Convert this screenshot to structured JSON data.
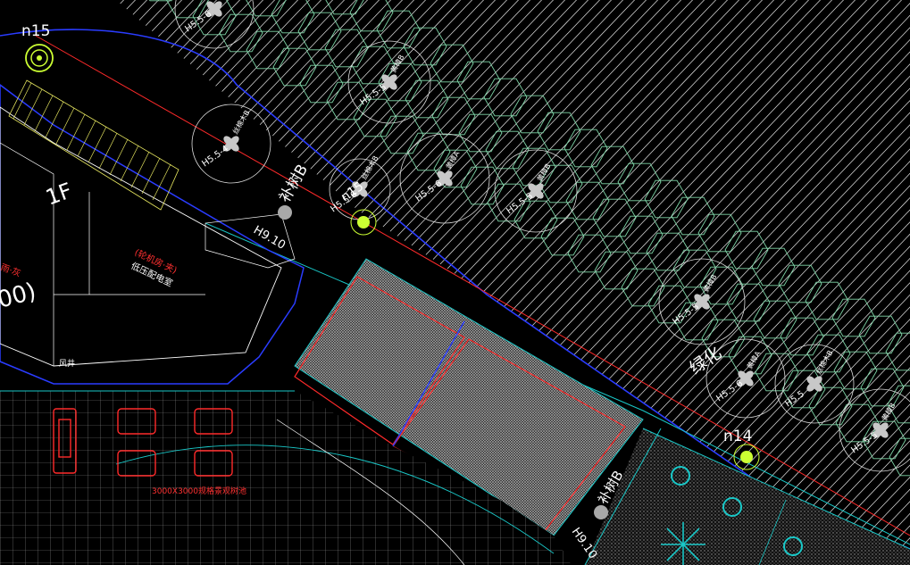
{
  "drawing": {
    "background": "#000000",
    "colors": {
      "hatch": "#bfbfbf",
      "green_line": "#7fd6a8",
      "cyan": "#19c8c8",
      "blue": "#2a3cff",
      "red": "#ff2a2a",
      "yellow": "#e8e860",
      "lamp": "#ccff33",
      "white": "#ffffff",
      "grey_dot": "#a8a8a8"
    },
    "building": {
      "floor_label": "1F",
      "paren_label": "00)",
      "note_red": "(轮机房·夹)",
      "room_label": "低压配电室",
      "shaft_label": "风井",
      "red_left_label": "雨·灰"
    },
    "lamps": [
      {
        "id": "lamp-n15-top",
        "label": "n15"
      },
      {
        "id": "lamp-n15-mid",
        "label": "n15"
      },
      {
        "id": "lamp-n14",
        "label": "n14"
      }
    ],
    "trees": [
      {
        "name": "",
        "code": "H5.5-6"
      },
      {
        "name": "黄樟B",
        "code": "H5.5-5"
      },
      {
        "name": "丝棉木B",
        "code": "H5.5-4"
      },
      {
        "name": "丝棉木B",
        "code": "H5.5-6"
      },
      {
        "name": "黄樟A",
        "code": "H5.5-6"
      },
      {
        "name": "黄樟B",
        "code": "H5.5-5"
      },
      {
        "name": "黄樟B",
        "code": "H5.5-5"
      },
      {
        "name": "黄樟A",
        "code": "H5.5-6"
      },
      {
        "name": "丝棉木B",
        "code": "H5.5"
      },
      {
        "name": "黄樟B",
        "code": "H5.5-5"
      }
    ],
    "labels": {
      "tree_b_1": "补树B",
      "tree_b_2": "补树B",
      "green_area": "绿化",
      "elev_1": "H9.10",
      "elev_2": "H9.10",
      "red_bottom": "3000X3000规格景观树池"
    }
  }
}
